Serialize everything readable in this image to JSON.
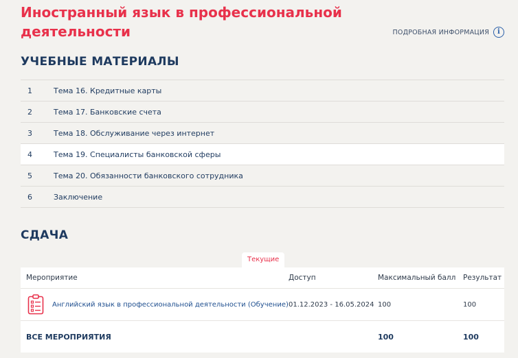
{
  "course": {
    "title": "Иностранный язык в профессиональной деятельности",
    "details_label": "ПОДРОБНАЯ ИНФОРМАЦИЯ",
    "info_glyph": "i"
  },
  "materials": {
    "heading": "УЧЕБНЫЕ МАТЕРИАЛЫ",
    "items": [
      {
        "num": "1",
        "label": "Тема 16. Кредитные карты"
      },
      {
        "num": "2",
        "label": "Тема 17. Банковские счета"
      },
      {
        "num": "3",
        "label": "Тема 18. Обслуживание через интернет"
      },
      {
        "num": "4",
        "label": "Тема 19. Специалисты банковской сферы"
      },
      {
        "num": "5",
        "label": "Тема 20. Обязанности банковского сотрудника"
      },
      {
        "num": "6",
        "label": "Заключение"
      }
    ]
  },
  "submission": {
    "heading": "СДАЧА",
    "tab_current": "Текущие",
    "columns": {
      "event": "Мероприятие",
      "access": "Доступ",
      "max_score": "Максимальный балл",
      "result": "Результат"
    },
    "rows": [
      {
        "icon": "checklist-document-icon",
        "event": "Английский язык в профессиональной деятельности (Обучение)",
        "access": "01.12.2023 - 16.05.2024",
        "max_score": "100",
        "result": "100"
      }
    ],
    "total": {
      "label": "ВСЕ МЕРОПРИЯТИЯ",
      "max_score": "100",
      "result": "100"
    }
  },
  "colors": {
    "accent_red": "#e8314b",
    "navy": "#1e3a5f",
    "background": "#f3f2ef"
  }
}
